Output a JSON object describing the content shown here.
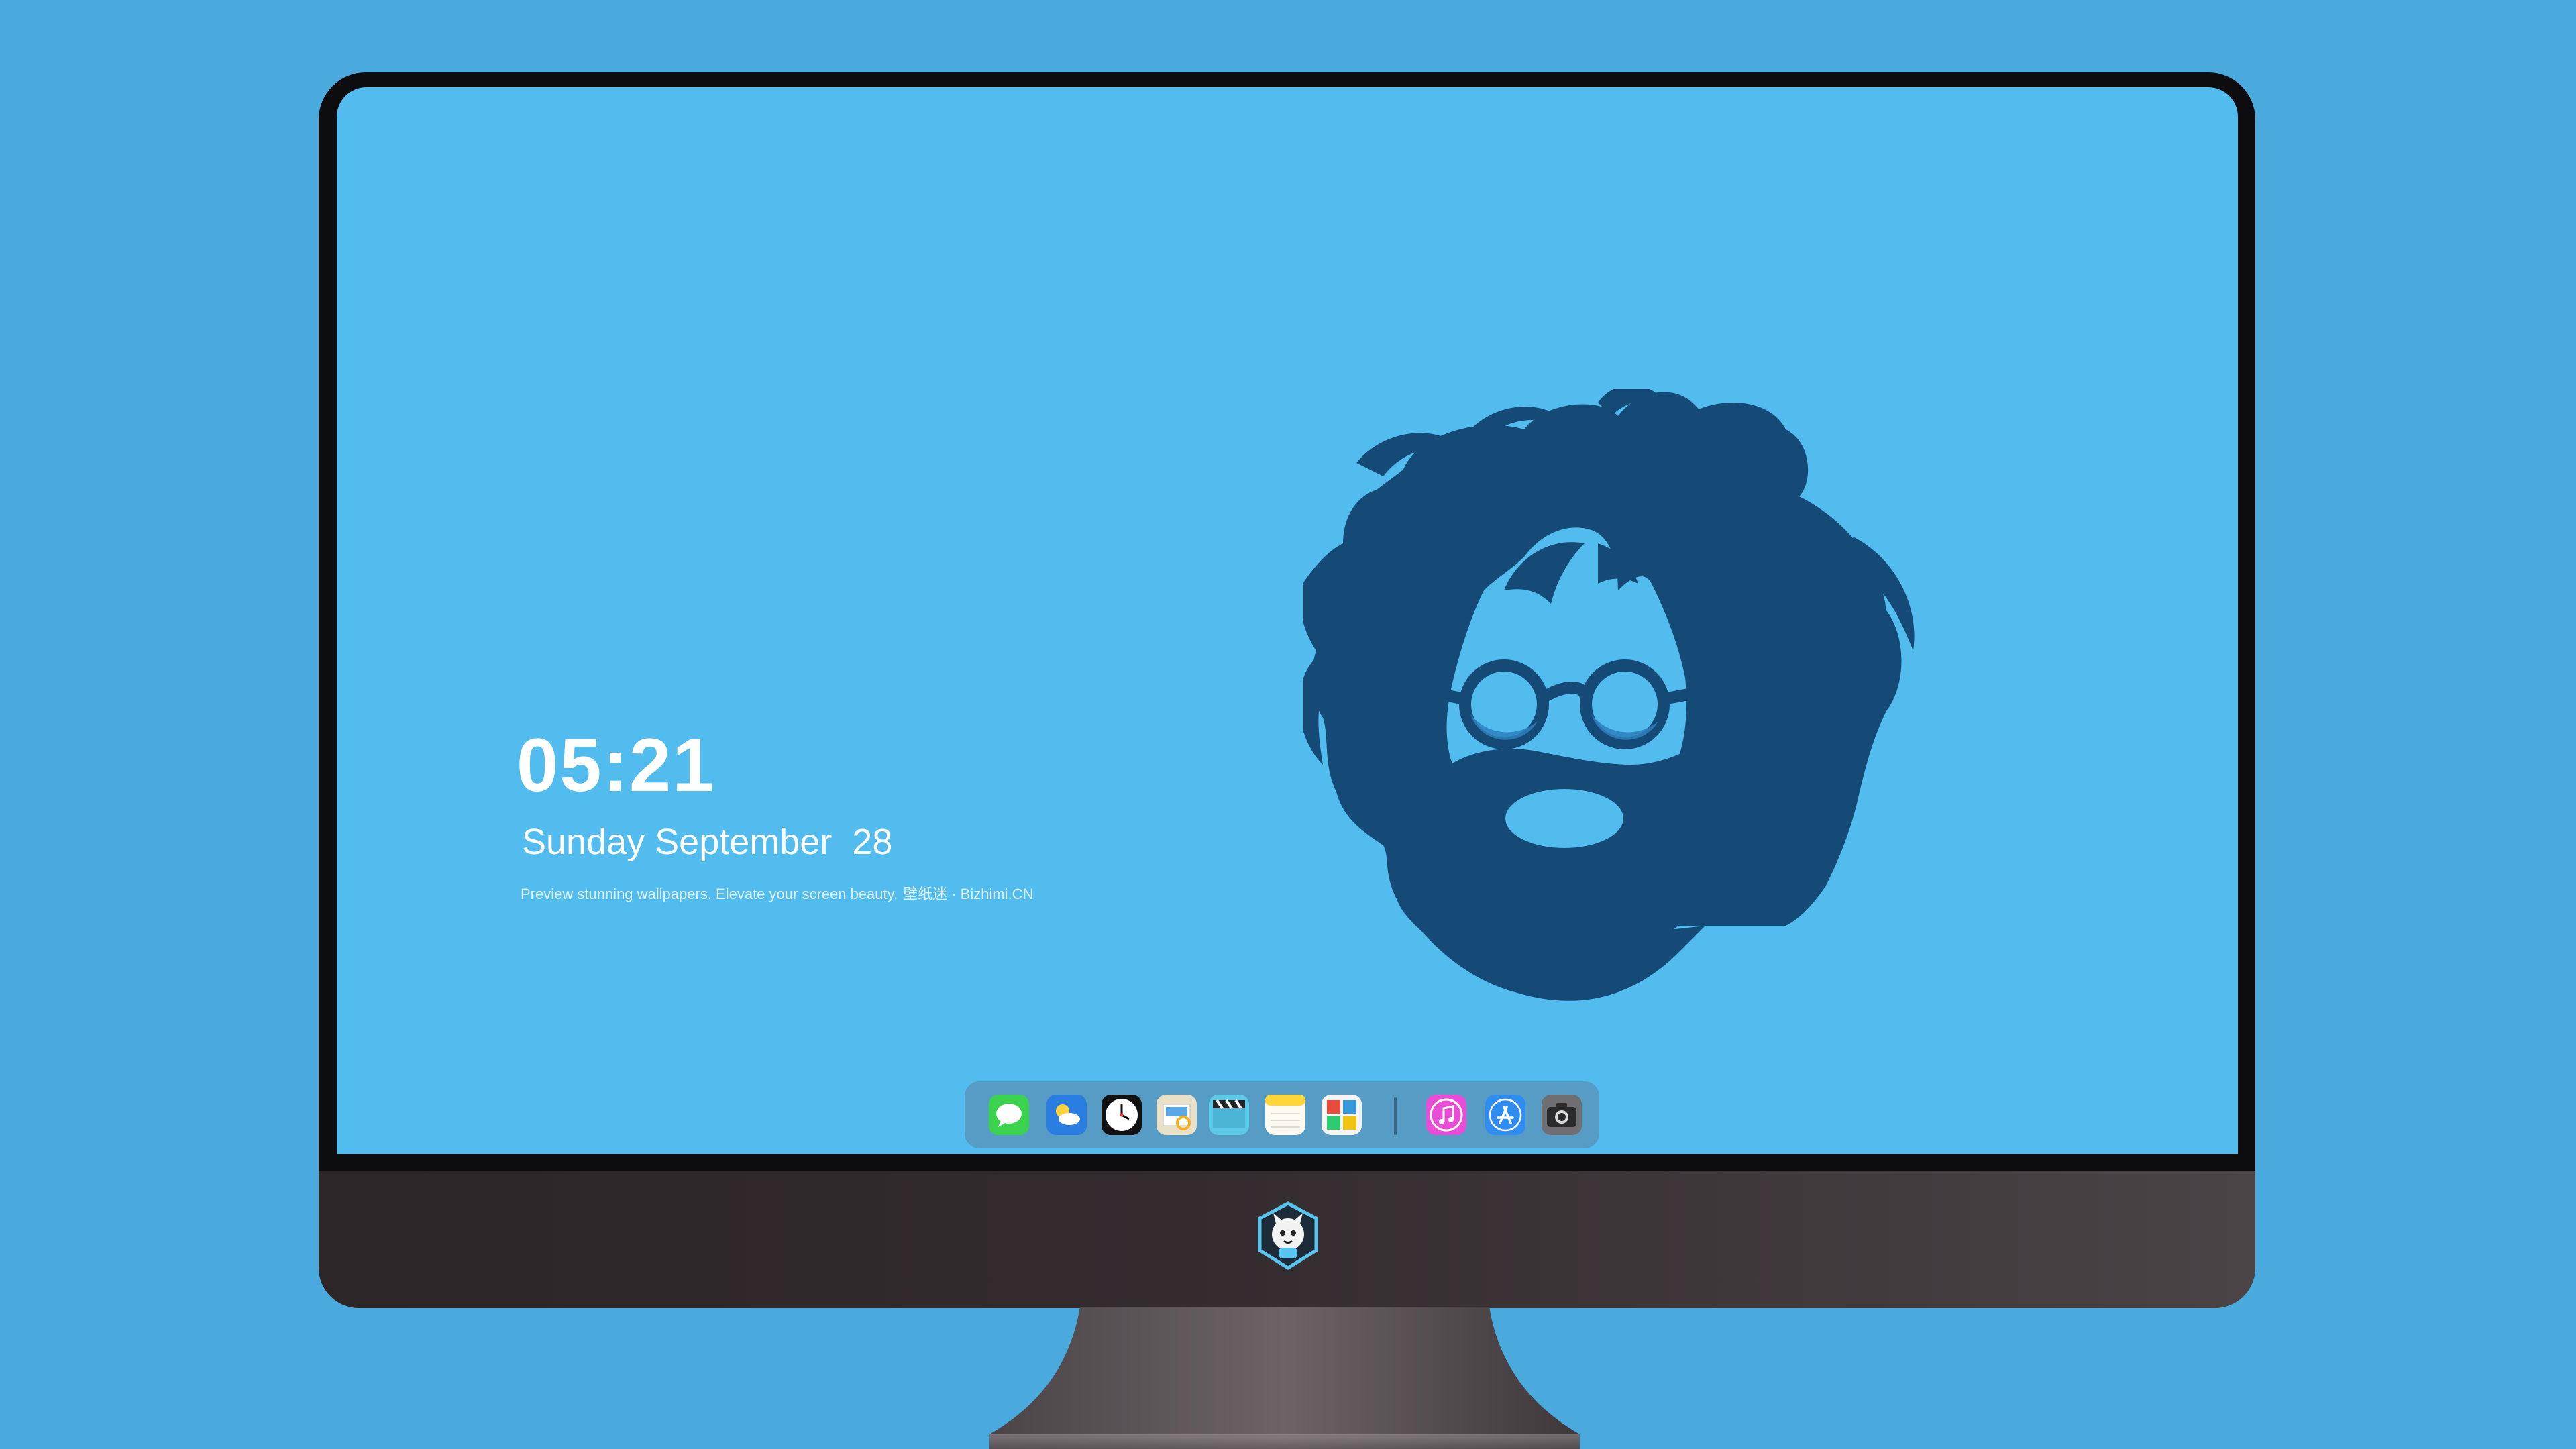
{
  "lockscreen": {
    "time": "05:21",
    "date": "Sunday September  28",
    "promo_text": "Preview stunning wallpapers. Elevate your screen beauty.",
    "promo_brand": "壁纸迷 · Bizhimi.CN"
  },
  "dock": {
    "apps": [
      {
        "name": "Messages",
        "icon": "messages-icon"
      },
      {
        "name": "Weather",
        "icon": "weather-icon"
      },
      {
        "name": "Clock",
        "icon": "clock-icon"
      },
      {
        "name": "Preview",
        "icon": "preview-icon"
      },
      {
        "name": "Clips",
        "icon": "clapperboard-icon"
      },
      {
        "name": "Notes",
        "icon": "notes-icon"
      },
      {
        "name": "Photo Booth",
        "icon": "photo-booth-icon"
      },
      {
        "name": "iTunes",
        "icon": "music-icon"
      },
      {
        "name": "App Store",
        "icon": "app-store-icon"
      },
      {
        "name": "Camera",
        "icon": "camera-icon"
      }
    ]
  },
  "colors": {
    "background": "#4aa9dd",
    "screen": "#52bcef",
    "silhouette": "#144a75",
    "bezel": "#0d0d0f"
  }
}
